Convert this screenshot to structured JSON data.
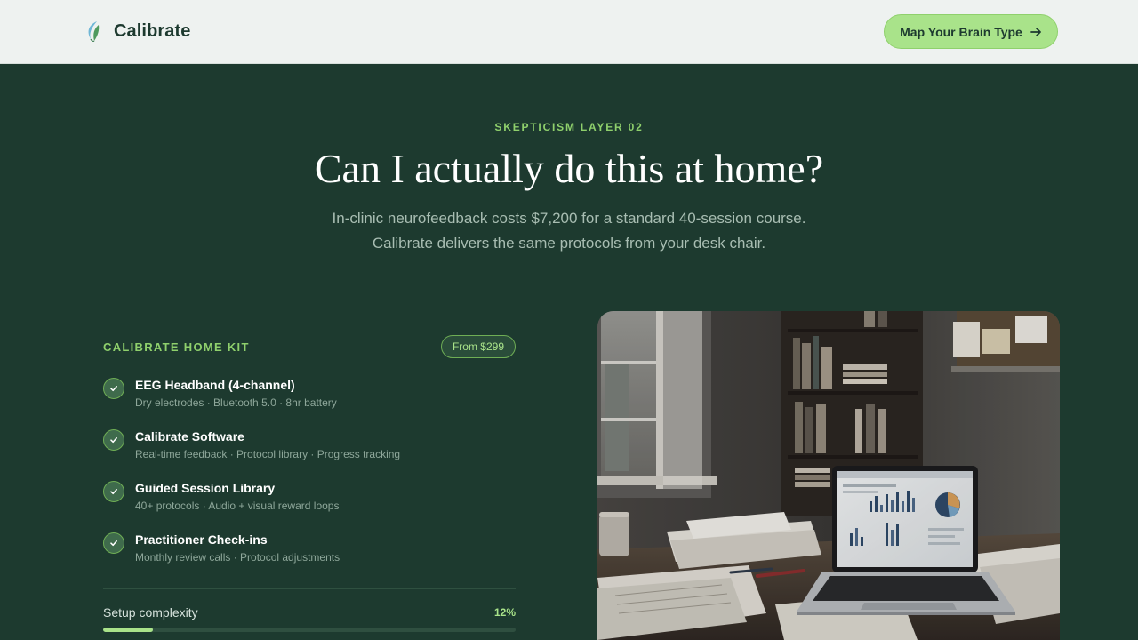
{
  "nav": {
    "brand": "Calibrate",
    "logo_icon": "leaf-swirl-icon",
    "cta_label": "Map Your Brain Type",
    "cta_icon": "arrow-right-icon"
  },
  "hero": {
    "eyebrow": "SKEPTICISM LAYER 02",
    "headline": "Can I actually do this at home?",
    "subline_1": "In-clinic neurofeedback costs $7,200 for a standard 40-session course.",
    "subline_2": "Calibrate delivers the same protocols from your desk chair."
  },
  "kit": {
    "title": "CALIBRATE HOME KIT",
    "price_badge": "From $299",
    "features": [
      {
        "title": "EEG Headband (4-channel)",
        "desc": "Dry electrodes · Bluetooth 5.0 · 8hr battery",
        "icon": "check-icon"
      },
      {
        "title": "Calibrate Software",
        "desc": "Real-time feedback · Protocol library · Progress tracking",
        "icon": "check-icon"
      },
      {
        "title": "Guided Session Library",
        "desc": "40+ protocols · Audio + visual reward loops",
        "icon": "check-icon"
      },
      {
        "title": "Practitioner Check-ins",
        "desc": "Monthly review calls · Protocol adjustments",
        "icon": "check-icon"
      }
    ],
    "meter": {
      "label": "Setup complexity",
      "value_text": "12%",
      "value": 0.12
    }
  },
  "colors": {
    "background": "#1d3a2f",
    "accent": "#a9e38a",
    "accent_text": "#8fd06c",
    "nav_background": "#eef2f0"
  }
}
